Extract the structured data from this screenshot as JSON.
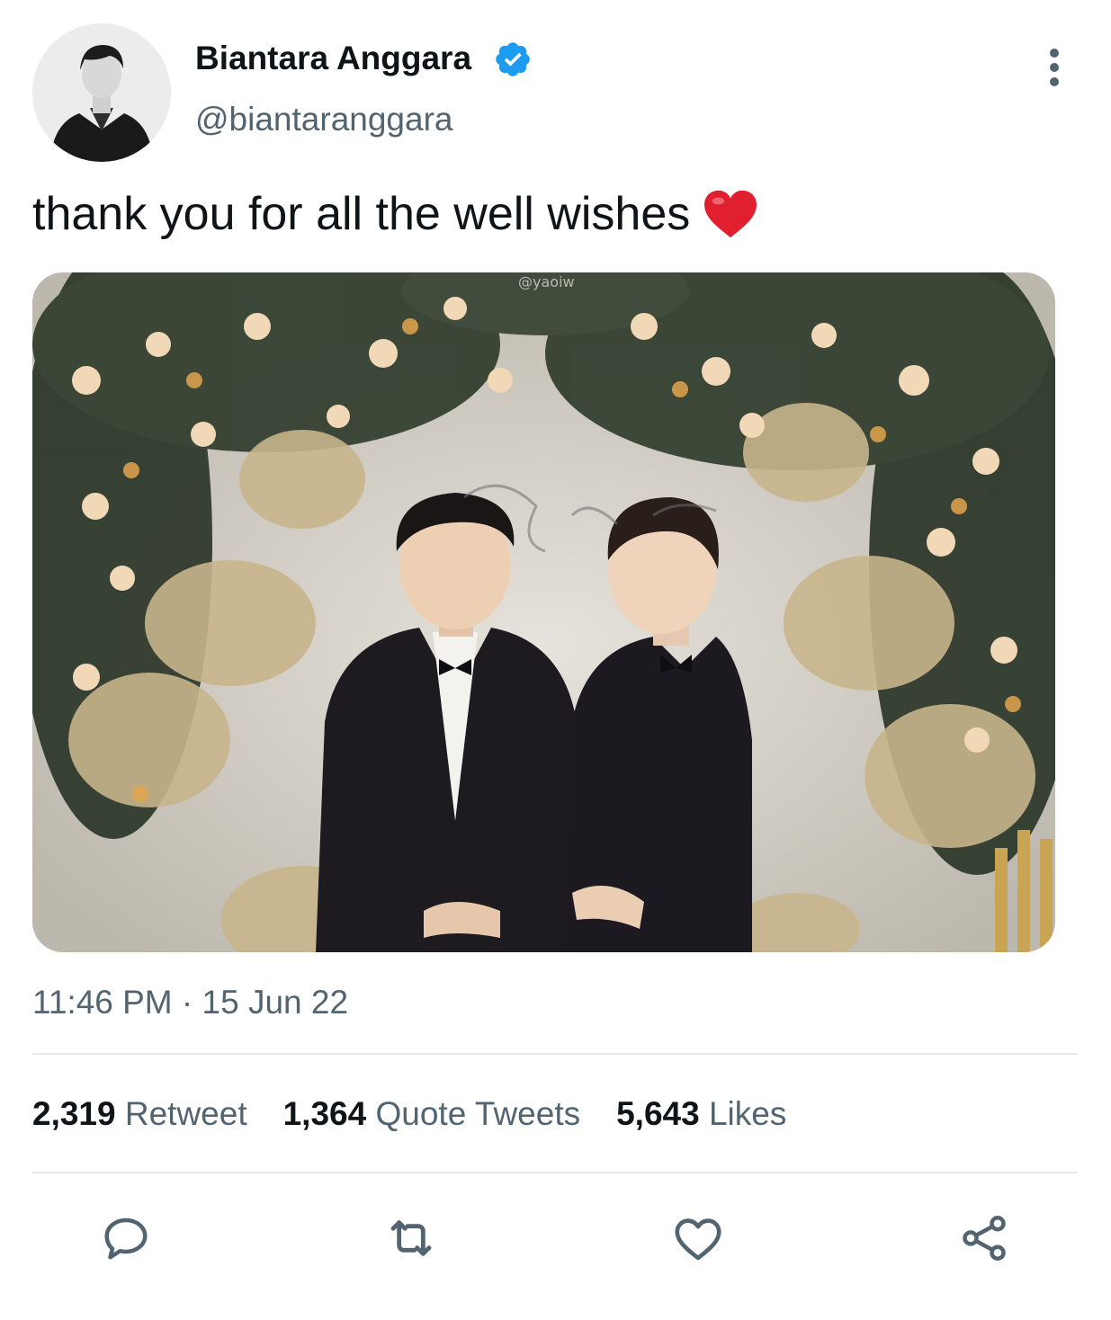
{
  "author": {
    "display_name": "Biantara Anggara",
    "handle": "@biantaranggara",
    "verified": true
  },
  "tweet": {
    "text": "thank you for all the well wishes",
    "emoji": "red-heart",
    "image_caption_watermark": "@yaoiw",
    "time": "11:46 PM",
    "separator": "·",
    "date": "15 Jun 22"
  },
  "stats": {
    "retweets_count": "2,319",
    "retweets_label": "Retweet",
    "quotes_count": "1,364",
    "quotes_label": "Quote Tweets",
    "likes_count": "5,643",
    "likes_label": "Likes"
  },
  "actions": [
    "reply-icon",
    "retweet-icon",
    "like-icon",
    "share-icon"
  ],
  "colors": {
    "text_primary": "#0f1419",
    "text_secondary": "#536471",
    "verified_blue": "#1d9bf0",
    "divider": "#e7e9ea",
    "heart_red": "#e0202f"
  }
}
